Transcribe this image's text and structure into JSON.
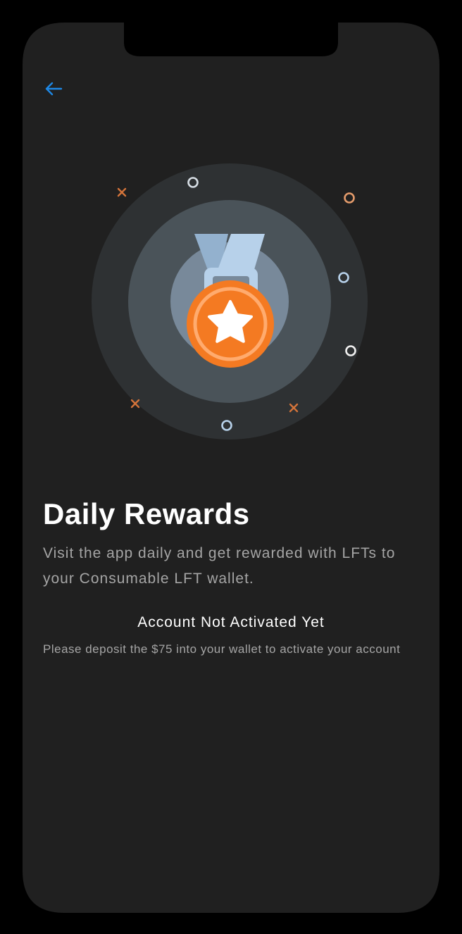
{
  "screen": {
    "title": "Daily Rewards",
    "subtitle": "Visit the app daily and get rewarded with LFTs to your Consumable LFT wallet.",
    "status_title": "Account Not Activated Yet",
    "status_description": "Please deposit the $75 into your wallet to activate your account"
  },
  "icons": {
    "back": "arrow-left-icon",
    "hero": "medal-star-icon"
  },
  "colors": {
    "screen_bg": "#202020",
    "accent_blue": "#1e88e5",
    "medal_orange": "#f47a22",
    "ribbon_blue": "#b7d1ea",
    "sparkle_orange": "#d3733a",
    "sparkle_light": "#d6dde4"
  }
}
